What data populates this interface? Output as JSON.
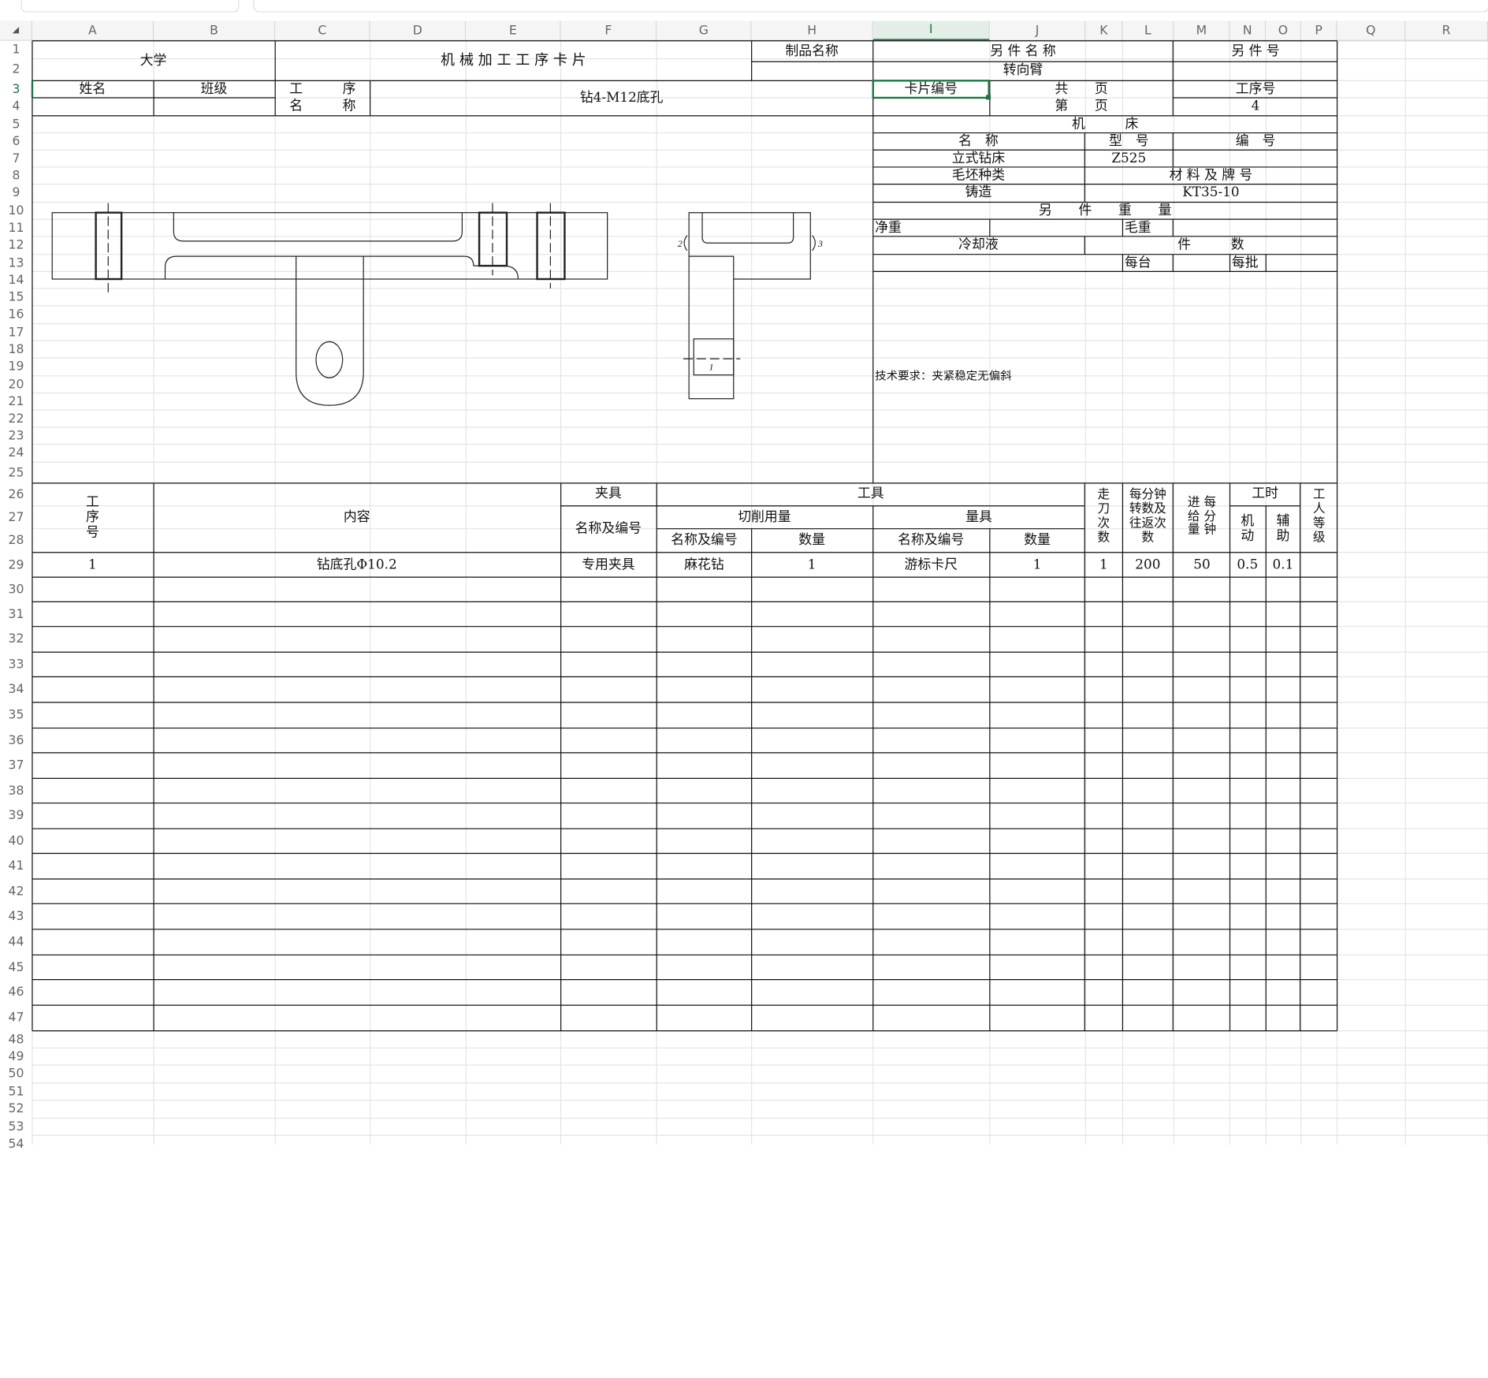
{
  "columns": [
    "A",
    "B",
    "C",
    "D",
    "E",
    "F",
    "G",
    "H",
    "I",
    "J",
    "K",
    "L",
    "M",
    "N",
    "O",
    "P",
    "Q",
    "R"
  ],
  "rows": [
    "1",
    "2",
    "3",
    "4",
    "5",
    "6",
    "7",
    "8",
    "9",
    "10",
    "11",
    "12",
    "13",
    "14",
    "15",
    "16",
    "17",
    "18",
    "19",
    "20",
    "21",
    "22",
    "23",
    "24",
    "25",
    "26",
    "27",
    "28",
    "29",
    "30",
    "31",
    "32",
    "33",
    "34",
    "35",
    "36",
    "37",
    "38",
    "39",
    "40",
    "41",
    "42",
    "43",
    "44",
    "45",
    "46",
    "47",
    "48",
    "49",
    "50",
    "51",
    "52",
    "53",
    "54"
  ],
  "selected": {
    "column": "I",
    "row": "3"
  },
  "header": {
    "school": "大学",
    "card_title": "机 械 加 工 工 序 卡 片",
    "product_name_label": "制品名称",
    "part_name_label": "另 件 名 称",
    "part_no_label": "另 件 号",
    "part_name_value": "转向臂",
    "name_label": "姓名",
    "class_label": "班级",
    "process_label_1": "工　　　序",
    "process_label_2": "名　　　称",
    "process_name": "钻4-M12底孔",
    "card_no_label": "卡片编号",
    "total_pages_label": "共　　页",
    "page_label": "第　　页",
    "process_no_label": "工序号",
    "process_no_value": "4"
  },
  "machine": {
    "title": "机　　　床",
    "name_label": "名　称",
    "model_label": "型　号",
    "number_label": "编　号",
    "name_value": "立式钻床",
    "model_value": "Z525",
    "blank_type_label": "毛坯种类",
    "material_label": "材 料 及 牌 号",
    "blank_type_value": "铸造",
    "material_value": "KT35-10",
    "weight_title": "另　　件　　重　　量",
    "net_weight_label": "净重",
    "gross_weight_label": "毛重",
    "coolant_label": "冷却液",
    "count_label": "件　　　数",
    "per_unit_label": "每台",
    "per_batch_label": "每批"
  },
  "tech_requirement": "技术要求：夹紧稳定无偏斜",
  "drawing": {
    "side_labels": [
      "2",
      "3",
      "1"
    ]
  },
  "ops_header": {
    "step_no": "工\n序\n号",
    "content": "内容",
    "fixture": "夹具",
    "fixture_name": "名称及编号",
    "tool": "工具",
    "cutting": "切削用量",
    "gauge": "量具",
    "tool_name": "名称及编号",
    "tool_qty": "数量",
    "gauge_name": "名称及编号",
    "gauge_qty": "数量",
    "passes": "走\n刀\n次\n数",
    "rpm": "每分钟\n转数及\n往返次\n数",
    "feed": "进 每\n给 分\n量 钟",
    "time": "工时",
    "machine_time": "机\n动",
    "aux_time": "辅\n助",
    "worker_grade": "工\n人\n等\n级"
  },
  "ops_rows": [
    {
      "step": "1",
      "content": "钻底孔Φ10.2",
      "fixture": "专用夹具",
      "tool": "麻花钻",
      "tool_qty": "1",
      "gauge": "游标卡尺",
      "gauge_qty": "1",
      "passes": "1",
      "rpm": "200",
      "feed": "50",
      "machine_time": "0.5",
      "aux_time": "0.1"
    }
  ]
}
